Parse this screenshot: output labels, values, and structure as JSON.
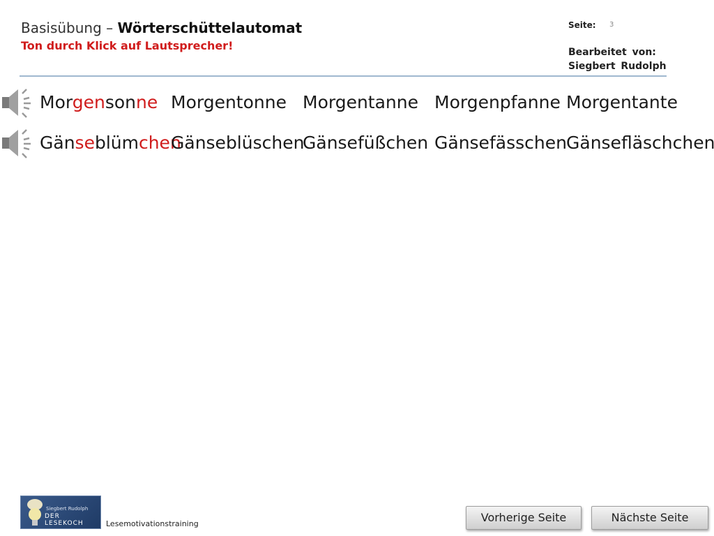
{
  "header": {
    "title_light": "Basisübung – ",
    "title_bold": "Wörterschüttelautomat",
    "subtitle": "Ton durch Klick auf Lautsprecher!",
    "page_label": "Seite:",
    "page_number": "3",
    "editor_label": "Bearbeitet von:",
    "editor_name": "Siegbert Rudolph"
  },
  "rows": [
    {
      "speaker_icon": "speaker-icon",
      "words": [
        {
          "segments": [
            {
              "text": "Mor",
              "red": false
            },
            {
              "text": "gen",
              "red": true
            },
            {
              "text": "son",
              "red": false
            },
            {
              "text": "ne",
              "red": true
            }
          ]
        },
        {
          "segments": [
            {
              "text": "Morgentonne",
              "red": false
            }
          ]
        },
        {
          "segments": [
            {
              "text": "Morgentanne",
              "red": false
            }
          ]
        },
        {
          "segments": [
            {
              "text": "Morgenpfanne",
              "red": false
            }
          ]
        },
        {
          "segments": [
            {
              "text": "Morgentante",
              "red": false
            }
          ]
        }
      ]
    },
    {
      "speaker_icon": "speaker-icon",
      "words": [
        {
          "segments": [
            {
              "text": "Gän",
              "red": false
            },
            {
              "text": "se",
              "red": true
            },
            {
              "text": "blüm",
              "red": false
            },
            {
              "text": "chen",
              "red": true
            }
          ]
        },
        {
          "segments": [
            {
              "text": "Gänseblüschen",
              "red": false
            }
          ]
        },
        {
          "segments": [
            {
              "text": "Gänsefüßchen",
              "red": false
            }
          ]
        },
        {
          "segments": [
            {
              "text": "Gänsefässchen",
              "red": false
            }
          ]
        },
        {
          "segments": [
            {
              "text": "Gänsefläschchen",
              "red": false
            }
          ]
        }
      ]
    }
  ],
  "footer": {
    "logo_line1": "Siegbert Rudolph",
    "logo_line2": "DER LESEKOCH",
    "label": "Lesemotivationstraining",
    "prev_button": "Vorherige Seite",
    "next_button": "Nächste Seite"
  },
  "colors": {
    "accent_red": "#d01c1c",
    "rule": "#9fb8cf"
  }
}
